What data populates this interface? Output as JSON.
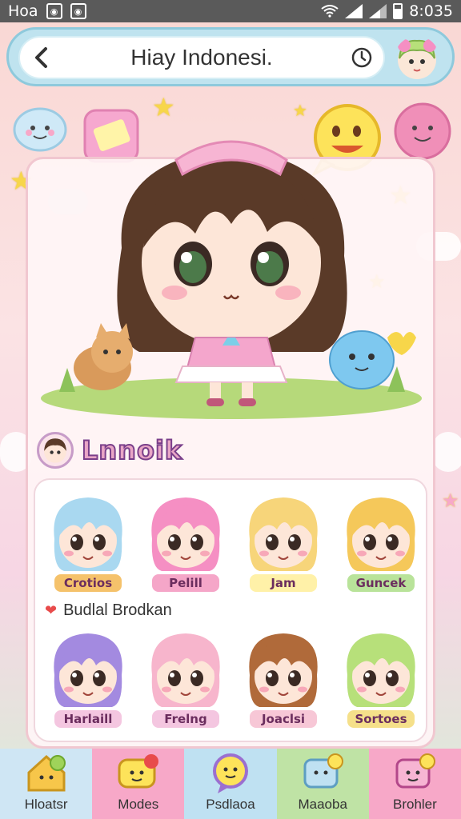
{
  "status_bar": {
    "carrier": "Hoa",
    "time": "8:035"
  },
  "app_bar": {
    "title": "Hiay Indonesi.",
    "back_icon": "back-arrow-icon",
    "clock_icon": "clock-icon"
  },
  "section": {
    "title": "Lnnoik"
  },
  "characters_row1": [
    {
      "label": "Crotios",
      "hair": "#a9d8f0",
      "tag": "#f5c26b"
    },
    {
      "label": "Pelill",
      "hair": "#f58fc3",
      "tag": "#f5a6c8"
    },
    {
      "label": "Jam",
      "hair": "#f7d57a",
      "tag": "#fff1a8"
    },
    {
      "label": "Guncek",
      "hair": "#f5c85a",
      "tag": "#b9e39a"
    }
  ],
  "sub_heading": "Budlal Brodkan",
  "characters_row2": [
    {
      "label": "Harlaill",
      "hair": "#a38ae0",
      "tag": "#f4c6e0"
    },
    {
      "label": "Frelng",
      "hair": "#f7b5cc",
      "tag": "#f4c6e0"
    },
    {
      "label": "Joaclsi",
      "hair": "#b06a3a",
      "tag": "#f7c7d6"
    },
    {
      "label": "Sortoes",
      "hair": "#b7e07a",
      "tag": "#f5e08a"
    }
  ],
  "bottom_nav": [
    {
      "label": "Hloatsr",
      "bg": "#cfe6f4",
      "icon": "home-icon"
    },
    {
      "label": "Modes",
      "bg": "#f7a8c8",
      "icon": "chat-face-icon"
    },
    {
      "label": "Psdlaoa",
      "bg": "#bfe1f2",
      "icon": "speech-bubble-icon"
    },
    {
      "label": "Maaoba",
      "bg": "#bfe3a5",
      "icon": "message-box-icon"
    },
    {
      "label": "Brohler",
      "bg": "#f7a8c8",
      "icon": "smile-box-icon"
    }
  ],
  "colors": {
    "accent_pink": "#f7a8c8",
    "accent_blue": "#bfe3ef",
    "hero_hair": "#5a3a28"
  }
}
